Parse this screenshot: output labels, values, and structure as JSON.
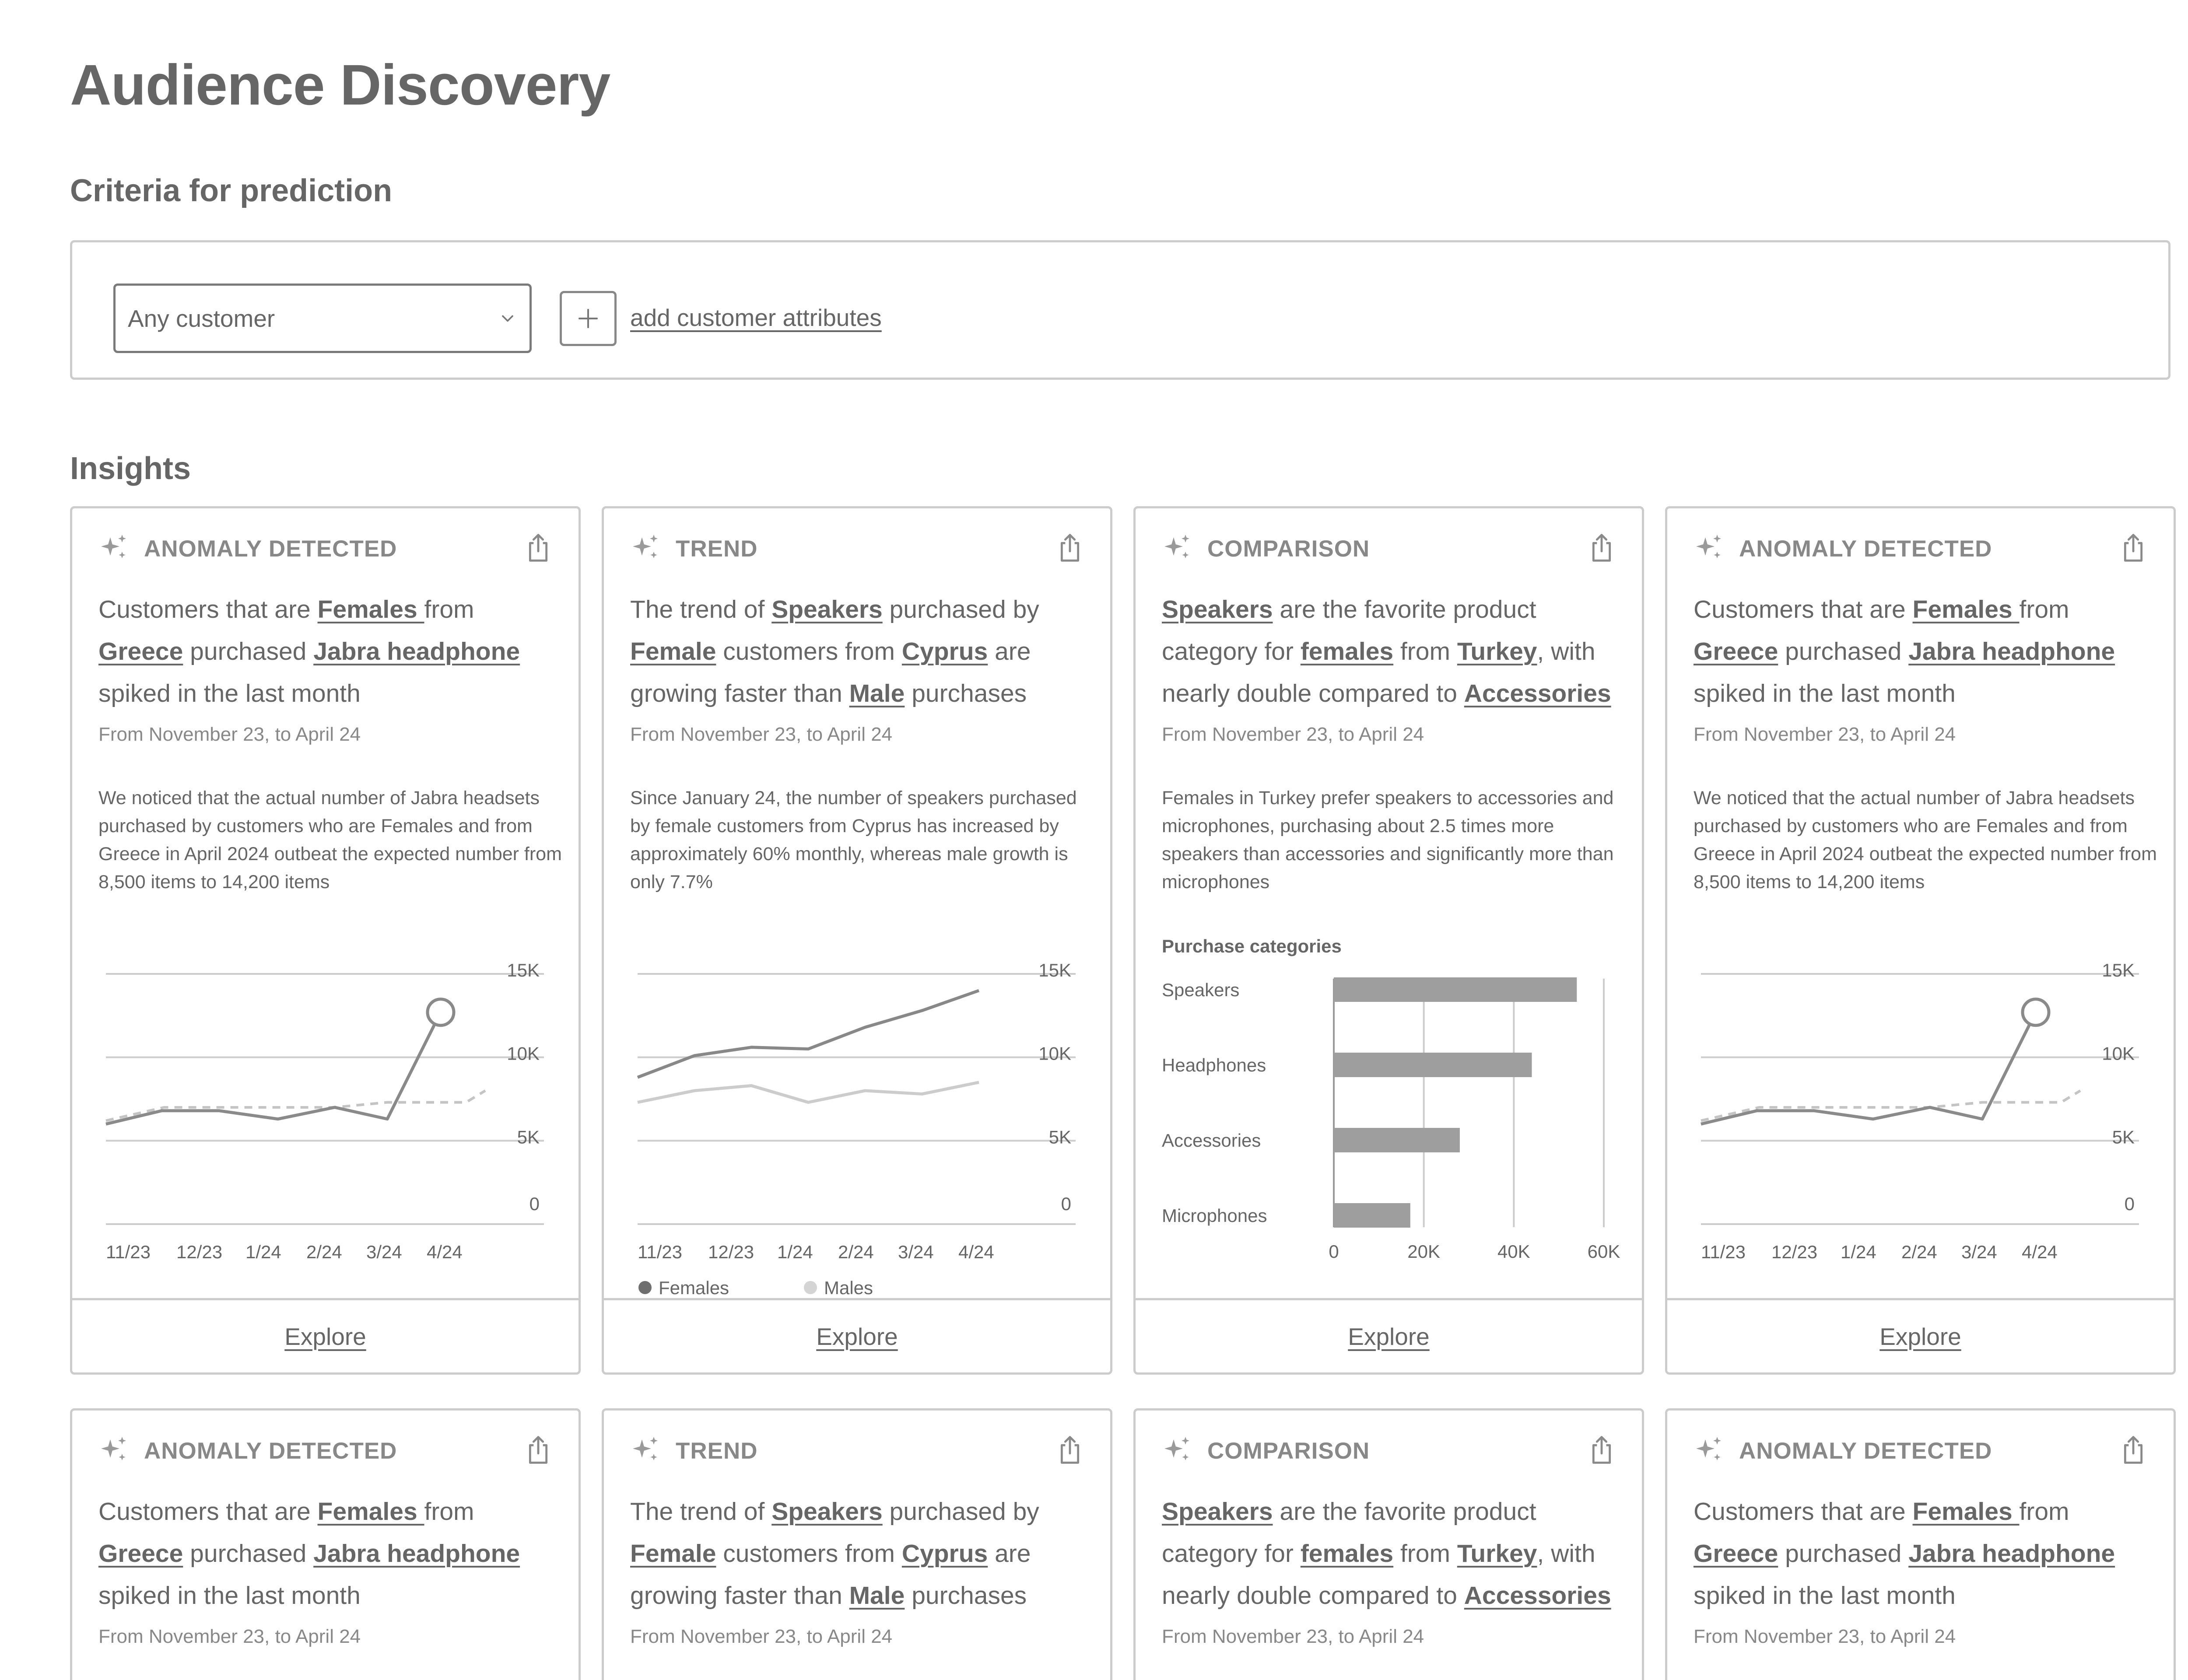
{
  "page": {
    "title": "Audience Discovery"
  },
  "criteria": {
    "title": "Criteria for prediction",
    "select_value": "Any customer",
    "add_label": "add customer attributes"
  },
  "insights": {
    "title": "Insights",
    "explore_label": "Explore",
    "cards": [
      {
        "type": "ANOMALY DETECTED",
        "headline": [
          {
            "t": "Customers that are "
          },
          {
            "t": "Females ",
            "h": true
          },
          {
            "t": "from "
          },
          {
            "t": "Greece",
            "h": true
          },
          {
            "t": " purchased "
          },
          {
            "t": "Jabra headphone ",
            "h": true
          },
          {
            "t": "spiked in the last month"
          }
        ],
        "date": "From November 23, to April 24",
        "description": "We noticed that the actual number of Jabra headsets purchased by customers who are Females and from Greece in April 2024 outbeat the expected number from 8,500 items to 14,200 items",
        "chart": "anomaly"
      },
      {
        "type": "TREND",
        "headline": [
          {
            "t": "The trend of "
          },
          {
            "t": "Speakers",
            "h": true
          },
          {
            "t": " purchased by "
          },
          {
            "t": "Female",
            "h": true
          },
          {
            "t": " customers from "
          },
          {
            "t": "Cyprus",
            "h": true
          },
          {
            "t": " are growing faster than "
          },
          {
            "t": "Male",
            "h": true
          },
          {
            "t": " purchases"
          }
        ],
        "date": "From November 23, to April 24",
        "description": "Since January 24, the number of speakers purchased by female customers from Cyprus has increased by approximately 60% monthly, whereas male growth is only 7.7%",
        "chart": "trend"
      },
      {
        "type": "COMPARISON",
        "headline": [
          {
            "t": "Speakers",
            "h": true
          },
          {
            "t": " are the favorite product category for "
          },
          {
            "t": "females",
            "h": true
          },
          {
            "t": " from "
          },
          {
            "t": "Turkey",
            "h": true
          },
          {
            "t": ", with nearly double compared to "
          },
          {
            "t": "Accessories",
            "h": true
          }
        ],
        "date": "From November 23, to April 24",
        "description": "Females in Turkey prefer speakers to accessories and microphones, purchasing about 2.5 times more speakers than accessories and significantly more than microphones",
        "chart": "comparison"
      },
      {
        "type": "ANOMALY DETECTED",
        "headline": [
          {
            "t": "Customers that are "
          },
          {
            "t": "Females ",
            "h": true
          },
          {
            "t": "from "
          },
          {
            "t": "Greece",
            "h": true
          },
          {
            "t": " purchased "
          },
          {
            "t": "Jabra headphone ",
            "h": true
          },
          {
            "t": "spiked in the last month"
          }
        ],
        "date": "From November 23, to April 24",
        "description": "We noticed that the actual number of Jabra headsets purchased by customers who are Females and from Greece in April 2024 outbeat the expected number from 8,500 items to 14,200 items",
        "chart": "anomaly"
      },
      {
        "type": "ANOMALY DETECTED",
        "headline": [
          {
            "t": "Customers that are "
          },
          {
            "t": "Females ",
            "h": true
          },
          {
            "t": "from "
          },
          {
            "t": "Greece",
            "h": true
          },
          {
            "t": " purchased "
          },
          {
            "t": "Jabra headphone ",
            "h": true
          },
          {
            "t": "spiked in the last month"
          }
        ],
        "date": "From November 23, to April 24"
      },
      {
        "type": "TREND",
        "headline": [
          {
            "t": "The trend of "
          },
          {
            "t": "Speakers",
            "h": true
          },
          {
            "t": " purchased by "
          },
          {
            "t": "Female",
            "h": true
          },
          {
            "t": " customers from "
          },
          {
            "t": "Cyprus",
            "h": true
          },
          {
            "t": " are growing faster than "
          },
          {
            "t": "Male",
            "h": true
          },
          {
            "t": " purchases"
          }
        ],
        "date": "From November 23, to April 24"
      },
      {
        "type": "COMPARISON",
        "headline": [
          {
            "t": "Speakers",
            "h": true
          },
          {
            "t": " are the favorite product category for "
          },
          {
            "t": "females",
            "h": true
          },
          {
            "t": " from "
          },
          {
            "t": "Turkey",
            "h": true
          },
          {
            "t": ", with nearly double compared to "
          },
          {
            "t": "Accessories",
            "h": true
          }
        ],
        "date": "From November 23, to April 24"
      },
      {
        "type": "ANOMALY DETECTED",
        "headline": [
          {
            "t": "Customers that are "
          },
          {
            "t": "Females ",
            "h": true
          },
          {
            "t": "from "
          },
          {
            "t": "Greece",
            "h": true
          },
          {
            "t": " purchased "
          },
          {
            "t": "Jabra headphone ",
            "h": true
          },
          {
            "t": "spiked in the last month"
          }
        ],
        "date": "From November 23, to April 24"
      }
    ]
  },
  "chart_data": [
    {
      "type": "line",
      "title": "",
      "x": [
        "11/23",
        "12/23",
        "1/24",
        "2/24",
        "3/24",
        "4/24"
      ],
      "ylim": [
        0,
        15000
      ],
      "y_ticks": [
        "0",
        "5K",
        "10K",
        "15K"
      ],
      "series": [
        {
          "role": "actual",
          "values": [
            6000,
            6800,
            6800,
            6300,
            7000,
            6300,
            12700
          ]
        },
        {
          "role": "expected",
          "values": [
            6200,
            7000,
            7000,
            7000,
            7000,
            7300,
            7300,
            7300,
            7300,
            8000
          ]
        }
      ],
      "highlight_point": 12700,
      "grid": true
    },
    {
      "type": "line",
      "x": [
        "11/23",
        "12/23",
        "1/24",
        "2/24",
        "3/24",
        "4/24"
      ],
      "ylim": [
        0,
        15000
      ],
      "y_ticks": [
        "0",
        "5K",
        "10K",
        "15K"
      ],
      "series": [
        {
          "name": "Females",
          "values": [
            8800,
            10100,
            10600,
            10500,
            11800,
            12800,
            14000
          ]
        },
        {
          "name": "Males",
          "values": [
            7300,
            8000,
            8300,
            7300,
            8000,
            7800,
            8500
          ]
        }
      ],
      "legend": "bottom-left",
      "colors": {
        "Females": "#777777",
        "Males": "#cccccc"
      },
      "grid": true
    },
    {
      "type": "bar",
      "orientation": "horizontal",
      "title": "Purchase categories",
      "categories": [
        "Speakers",
        "Headphones",
        "Accessories",
        "Microphones"
      ],
      "values": [
        54000,
        44000,
        28000,
        17000
      ],
      "xlim": [
        0,
        60000
      ],
      "x_ticks": [
        "0",
        "20K",
        "40K",
        "60K"
      ],
      "grid": true
    }
  ]
}
